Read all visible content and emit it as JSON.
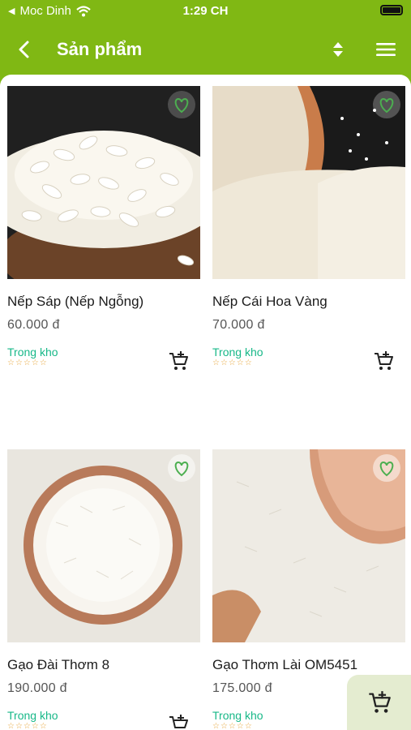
{
  "status_bar": {
    "carrier": "Moc Dinh",
    "time": "1:29 CH"
  },
  "nav": {
    "title": "Sản phẩm"
  },
  "products": [
    {
      "name": "Nếp Sáp (Nếp Ngỗng)",
      "price": "60.000 đ",
      "stock": "Trong kho",
      "stars": "☆☆☆☆☆",
      "rating": 0
    },
    {
      "name": "Nếp Cái Hoa Vàng",
      "price": "70.000 đ",
      "stock": "Trong kho",
      "stars": "☆☆☆☆☆",
      "rating": 0
    },
    {
      "name": "Gạo Đài Thơm 8",
      "price": "190.000 đ",
      "stock": "Trong kho",
      "stars": "☆☆☆☆☆",
      "rating": 0
    },
    {
      "name": "Gạo Thơm Lài OM5451",
      "price": "175.000 đ",
      "stock": "Trong kho",
      "stars": "☆☆☆☆☆",
      "rating": 0
    }
  ],
  "colors": {
    "header": "#80b814",
    "stock": "#18b888",
    "stars": "#e7a63a"
  }
}
